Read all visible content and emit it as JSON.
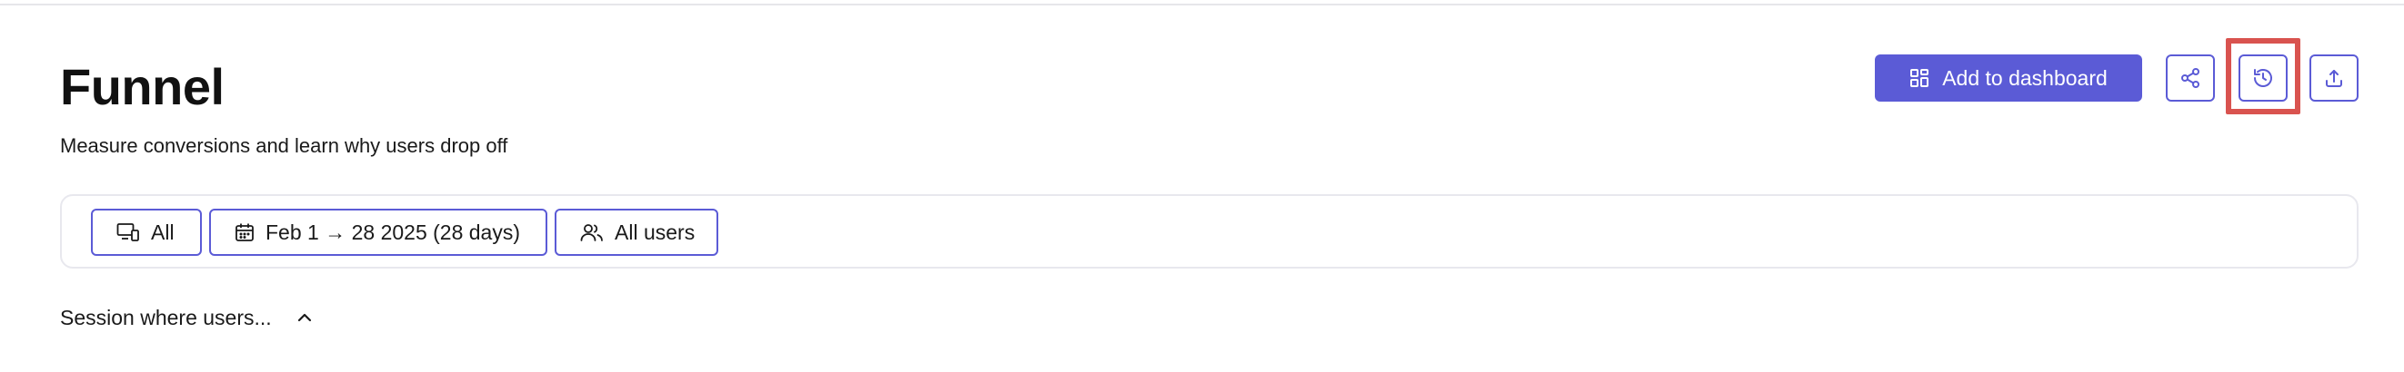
{
  "header": {
    "title": "Funnel",
    "subtitle": "Measure conversions and learn why users drop off",
    "actions": {
      "add_to_dashboard_label": "Add to dashboard",
      "share_icon": "share-icon",
      "history_icon": "history-icon",
      "export_icon": "upload-icon"
    },
    "highlighted_action": "history",
    "accent_color": "#5b5bd6",
    "highlight_color": "#d9534f"
  },
  "filters": {
    "devices_label": "All",
    "date_range_label": "Feb 1 → 28 2025 (28 days)",
    "audience_label": "All users"
  },
  "session": {
    "label": "Session where users...",
    "toggle_icon": "chevron-up-icon",
    "expanded": true
  }
}
